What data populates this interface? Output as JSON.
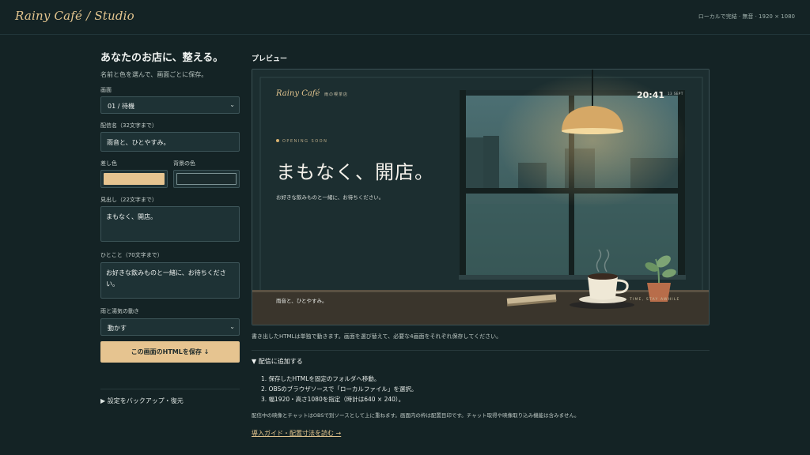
{
  "app": {
    "brand": "Rainy Café / Studio",
    "top_note": "ローカルで完結 · 無音 · 1920 × 1080"
  },
  "form": {
    "heading": "あなたのお店に、整える。",
    "subheading": "名前と色を選んで、画面ごとに保存。",
    "screen_label": "画面",
    "screen_value": "01 / 待機",
    "stream_name_label": "配信名（32文字まで）",
    "stream_name_value": "雨音と、ひとやすみ。",
    "accent_label": "差し色",
    "accent_color": "#e6c490",
    "bg_label": "背景の色",
    "bg_color": "#1b2b2d",
    "headline_label": "見出し（22文字まで）",
    "headline_value": "まもなく、開店。",
    "message_label": "ひとこと（70文字まで）",
    "message_value": "お好きな飲みものと一緒に、お待ちください。",
    "motion_label": "雨と湯気の動き",
    "motion_value": "動かす",
    "save_button": "この画面のHTMLを保存 ↓",
    "backup_label": "▶ 設定をバックアップ・復元"
  },
  "preview": {
    "title": "プレビュー",
    "brand": "Rainy Café",
    "brand_sub": "雨の喫茶店",
    "time": "20:41",
    "date": "13 SEPT",
    "opening": "OPENING SOON",
    "headline": "まもなく、開店。",
    "message": "お好きな飲みものと一緒に、お待ちください。",
    "footer": "雨音と、ひとやすみ。",
    "tagline": "TIME, STAY AWHILE"
  },
  "notes": {
    "standalone": "書き出したHTMLは単独で動きます。画面を選び替えて、必要な4画面をそれぞれ保存してください。",
    "add_title": "▼ 配信に追加する",
    "steps": [
      "1. 保存したHTMLを固定のフォルダへ移動。",
      "2. OBSのブラウザソースで「ローカルファイル」を選択。",
      "3. 幅1920・高さ1080を指定（時計は640 × 240）。"
    ],
    "overlay_note": "配信中の映像とチャットはOBSで別ソースとして上に重ねます。画面内の枠は配置目印です。チャット取得や映像取り込み機能は含みません。",
    "guide_link": "導入ガイド・配置寸法を読む →"
  },
  "colors": {
    "page_bg": "#142325",
    "accent": "#e6c490",
    "panel": "#1e3235"
  },
  "icons": [
    "chevron-down-icon",
    "chevron-down-icon"
  ]
}
